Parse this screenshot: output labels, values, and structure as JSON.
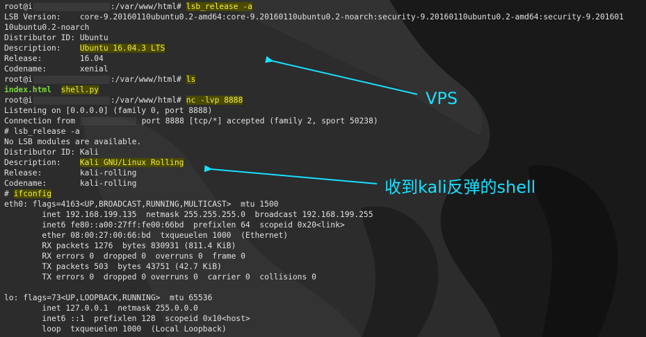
{
  "terminal": {
    "lines": [
      {
        "prompt_pre": "root@i",
        "prompt_post": ":/var/www/html#",
        "cmd": "lsb_release -a"
      },
      {
        "text": "LSB Version:    core-9.20160110ubuntu0.2-amd64:core-9.20160110ubuntu0.2-noarch:security-9.20160110ubuntu0.2-amd64:security-9.201601"
      },
      {
        "text": "10ubuntu0.2-noarch"
      },
      {
        "text": "Distributor ID: Ubuntu"
      },
      {
        "label": "Description:    ",
        "value": "Ubuntu 16.04.3 LTS"
      },
      {
        "text": "Release:        16.04"
      },
      {
        "text": "Codename:       xenial"
      },
      {
        "prompt_pre": "root@i",
        "prompt_post": ":/var/www/html#",
        "cmd": "ls"
      },
      {
        "files": [
          "index.html",
          "shell.py"
        ]
      },
      {
        "prompt_pre": "root@i",
        "prompt_post": ":/var/www/html#",
        "cmd": "nc -lvp 8888"
      },
      {
        "text": "Listening on [0.0.0.0] (family 0, port 8888)"
      },
      {
        "conn_pre": "Connection from ",
        "conn_post": " port 8888 [tcp/*] accepted (family 2, sport 50238)"
      },
      {
        "text": "# lsb_release -a"
      },
      {
        "text": "No LSB modules are available."
      },
      {
        "text": "Distributor ID: Kali"
      },
      {
        "label": "Description:    ",
        "value": "Kali GNU/Linux Rolling"
      },
      {
        "text": "Release:        kali-rolling"
      },
      {
        "text": "Codename:       kali-rolling"
      },
      {
        "root_prompt": "# ",
        "cmd": "ifconfig"
      },
      {
        "text": "eth0: flags=4163<UP,BROADCAST,RUNNING,MULTICAST>  mtu 1500"
      },
      {
        "text": "        inet 192.168.199.135  netmask 255.255.255.0  broadcast 192.168.199.255"
      },
      {
        "text": "        inet6 fe80::a00:27ff:fe00:66bd  prefixlen 64  scopeid 0x20<link>"
      },
      {
        "text": "        ether 08:00:27:00:66:bd  txqueuelen 1000  (Ethernet)"
      },
      {
        "text": "        RX packets 1276  bytes 830931 (811.4 KiB)"
      },
      {
        "text": "        RX errors 0  dropped 0  overruns 0  frame 0"
      },
      {
        "text": "        TX packets 503  bytes 43751 (42.7 KiB)"
      },
      {
        "text": "        TX errors 0  dropped 0 overruns 0  carrier 0  collisions 0"
      },
      {
        "text": ""
      },
      {
        "text": "lo: flags=73<UP,LOOPBACK,RUNNING>  mtu 65536"
      },
      {
        "text": "        inet 127.0.0.1  netmask 255.0.0.0"
      },
      {
        "text": "        inet6 ::1  prefixlen 128  scopeid 0x10<host>"
      },
      {
        "text": "        loop  txqueuelen 1000  (Local Loopback)"
      }
    ]
  },
  "annotations": {
    "vps_label": "VPS",
    "kali_label": "收到kali反弹的shell",
    "arrow_color": "#18e0ff"
  },
  "colors": {
    "background": "#2b2b2b",
    "text": "#e0e0e0",
    "highlight_bg": "#4a4a00",
    "highlight_fg": "#f2ee4a",
    "file_color": "#7cd63b"
  }
}
